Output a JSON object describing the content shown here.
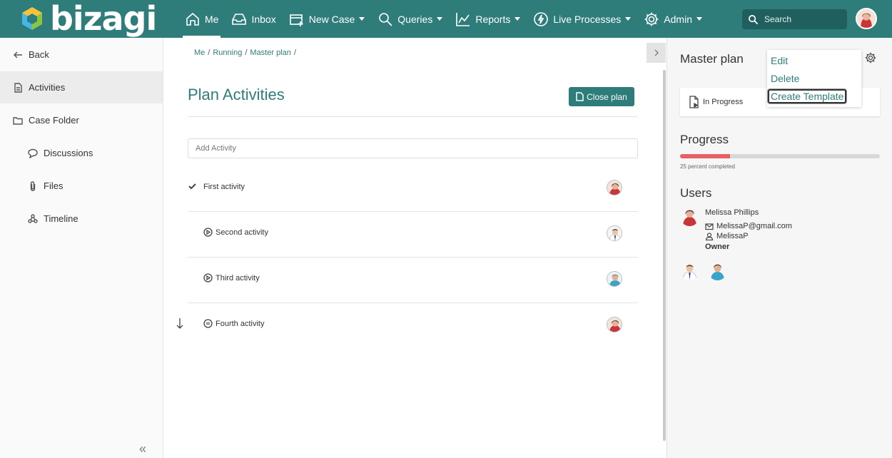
{
  "app": {
    "logo_text": "bizagi"
  },
  "nav": {
    "items": [
      {
        "label": "Me",
        "icon": "home-icon",
        "dropdown": false,
        "active": true
      },
      {
        "label": "Inbox",
        "icon": "inbox-icon",
        "dropdown": false,
        "active": false
      },
      {
        "label": "New Case",
        "icon": "new-case-icon",
        "dropdown": true,
        "active": false
      },
      {
        "label": "Queries",
        "icon": "search-icon",
        "dropdown": true,
        "active": false
      },
      {
        "label": "Reports",
        "icon": "chart-icon",
        "dropdown": true,
        "active": false
      },
      {
        "label": "Live Processes",
        "icon": "lightning-icon",
        "dropdown": true,
        "active": false
      },
      {
        "label": "Admin",
        "icon": "gear-icon",
        "dropdown": true,
        "active": false
      }
    ],
    "search_placeholder": "Search"
  },
  "sidebar": {
    "items": [
      {
        "label": "Back",
        "icon": "back-arrow-icon"
      },
      {
        "label": "Activities",
        "icon": "document-icon"
      },
      {
        "label": "Case Folder",
        "icon": "folder-icon"
      },
      {
        "label": "Discussions",
        "icon": "chat-bubble-icon"
      },
      {
        "label": "Files",
        "icon": "paperclip-icon"
      },
      {
        "label": "Timeline",
        "icon": "timeline-icon"
      }
    ],
    "collapse_symbol": "«"
  },
  "main": {
    "breadcrumb": [
      "Me",
      "Running",
      "Master plan"
    ],
    "breadcrumb_separator": "/",
    "title": "Plan Activities",
    "close_plan_label": "Close plan",
    "add_activity_placeholder": "Add Activity",
    "activities": [
      {
        "label": "First activity",
        "status": "completed",
        "icon": "checkmark-icon"
      },
      {
        "label": "Second activity",
        "status": "running",
        "icon": "play-circle-icon"
      },
      {
        "label": "Third activity",
        "status": "running",
        "icon": "play-circle-icon"
      },
      {
        "label": "Fourth activity",
        "status": "paused",
        "icon": "pause-circle-icon"
      }
    ]
  },
  "right_panel": {
    "title": "Master plan",
    "status": "In Progress",
    "menu": [
      "Edit",
      "Delete",
      "Create Template"
    ],
    "progress_title": "Progress",
    "progress_value": 0.25,
    "progress_text": "25 percent completed",
    "users_title": "Users",
    "user": {
      "name": "Melissa Phillips",
      "email": "MelissaP@gmail.com",
      "username": "MelissaP",
      "role": "Owner"
    }
  },
  "colors": {
    "brand": "#2e7d7b",
    "progress": "#e86062"
  }
}
